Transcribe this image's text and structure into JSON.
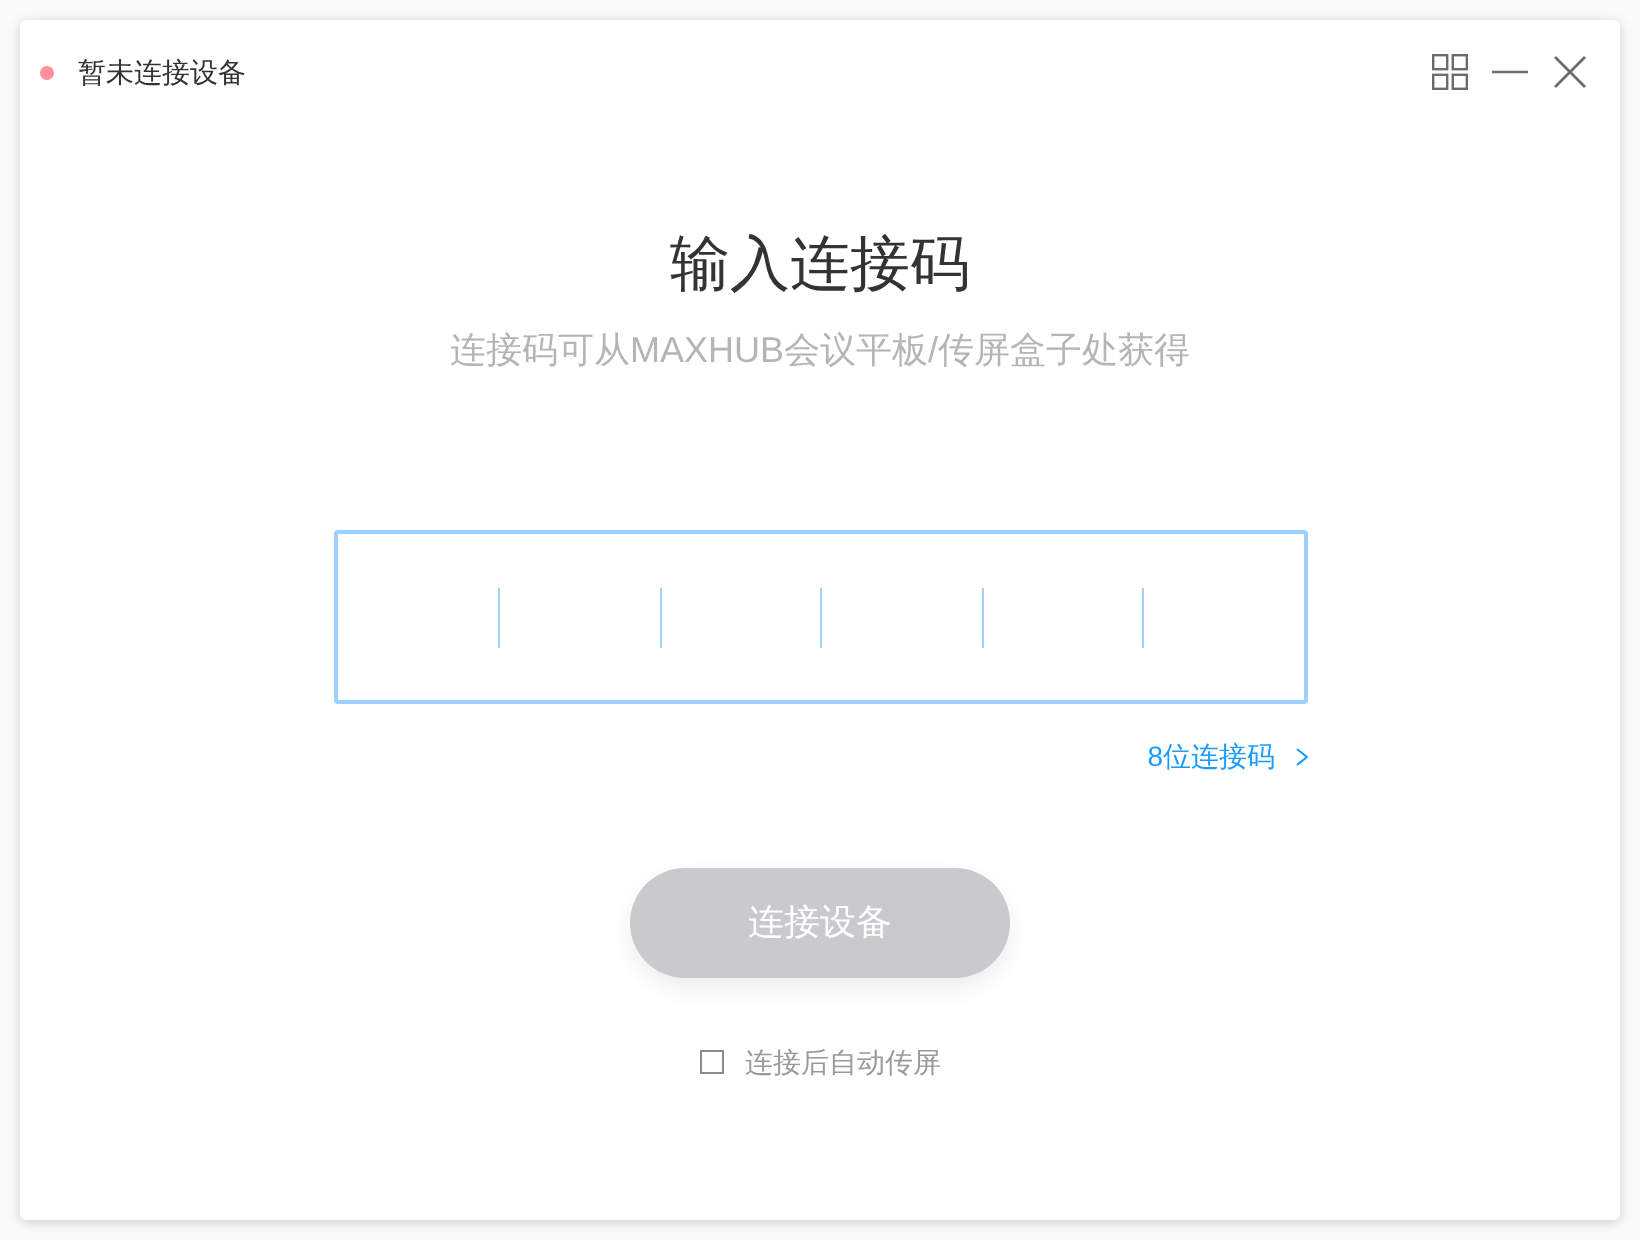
{
  "window": {
    "title": "暂未连接设备",
    "connected": false
  },
  "heading": "输入连接码",
  "subtitle": "连接码可从MAXHUB会议平板/传屏盒子处获得",
  "code_input": {
    "cells": [
      {
        "filled": false
      },
      {
        "filled": false
      },
      {
        "filled": false
      },
      {
        "filled": false
      },
      {
        "filled": false
      },
      {
        "filled": false
      }
    ]
  },
  "alt_code_link": {
    "label": "8位连接码"
  },
  "connect_button": {
    "label": "连接设备",
    "disabled": true
  },
  "auto_share": {
    "label": "连接后自动传屏",
    "checked": false
  }
}
